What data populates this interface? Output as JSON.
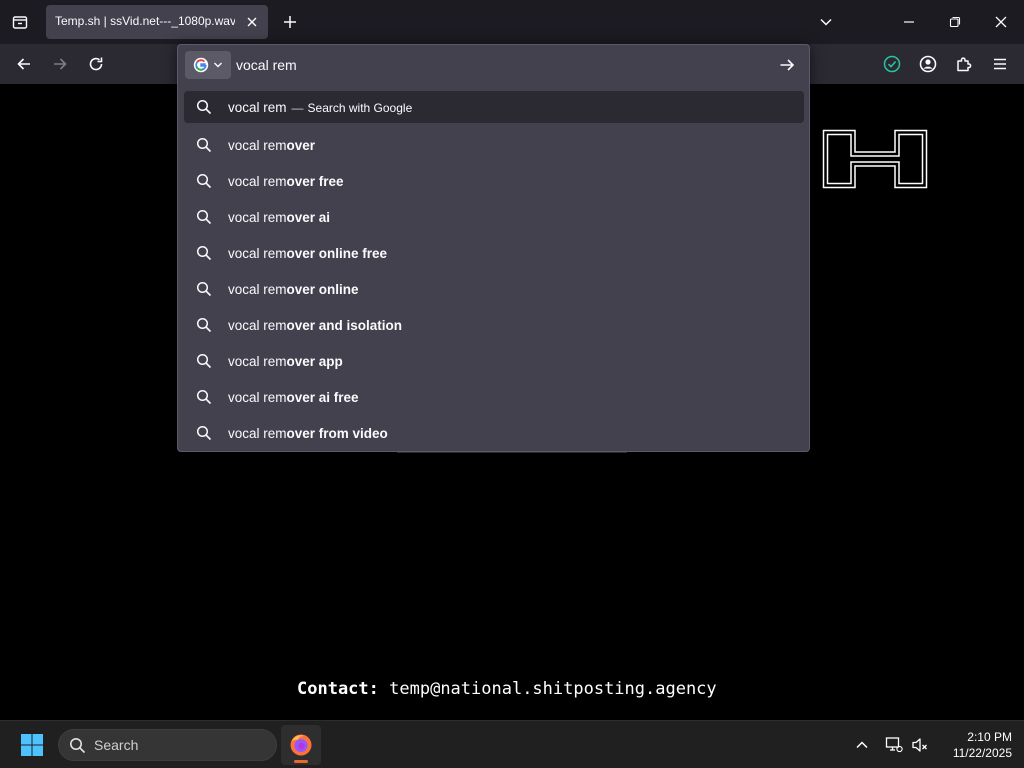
{
  "browser": {
    "tab": {
      "title": "Temp.sh | ssVid.net---_1080p.wav"
    },
    "urlbar": {
      "value": "vocal rem",
      "search_row": {
        "query": "vocal rem",
        "separator": "—",
        "action": "Search with Google"
      },
      "suggestions": [
        {
          "typed": "vocal rem",
          "completion": "over"
        },
        {
          "typed": "vocal rem",
          "completion": "over free"
        },
        {
          "typed": "vocal rem",
          "completion": "over ai"
        },
        {
          "typed": "vocal rem",
          "completion": "over online free"
        },
        {
          "typed": "vocal rem",
          "completion": "over online"
        },
        {
          "typed": "vocal rem",
          "completion": "over and isolation"
        },
        {
          "typed": "vocal rem",
          "completion": "over app"
        },
        {
          "typed": "vocal rem",
          "completion": "over ai free"
        },
        {
          "typed": "vocal rem",
          "completion": "over from video"
        }
      ]
    },
    "icons": {
      "tab_list": "tab-list-icon",
      "close_tab": "close-icon",
      "new_tab": "plus-icon",
      "overflow": "chevron-down-icon",
      "minimize": "minimize-icon",
      "restore": "restore-icon",
      "close_window": "close-icon",
      "back": "back-arrow-icon",
      "forward": "forward-arrow-icon",
      "reload": "reload-icon",
      "search_engine": "google-logo-icon",
      "go": "go-arrow-icon",
      "extension_check": "check-circle-icon",
      "account": "account-icon",
      "extensions": "puzzle-icon",
      "menu": "hamburger-menu-icon"
    }
  },
  "page": {
    "contact_label": "Contact:",
    "contact_email": "temp@national.shitposting.agency"
  },
  "taskbar": {
    "search_label": "Search",
    "time": "2:10 PM",
    "date": "11/22/2025",
    "accent_color": "#e8692e"
  },
  "colors": {
    "tabstrip_bg": "#1c1b22",
    "navbar_bg": "#2b2a33",
    "popup_bg": "#42414d",
    "check_accent": "#54ffbd"
  }
}
